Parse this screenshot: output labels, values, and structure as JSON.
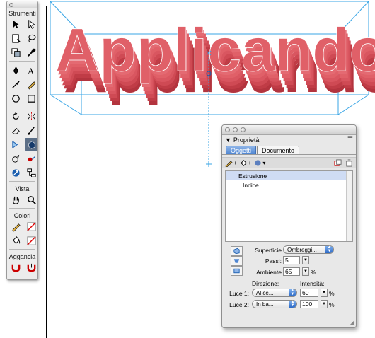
{
  "toolbox": {
    "title": "Strumenti",
    "section_view": "Vista",
    "section_colors": "Colori",
    "section_snap": "Aggancia"
  },
  "artwork": {
    "text": "Applicando",
    "face_color": "#e06068",
    "extrude_color": "#c43c46",
    "guide_color": "#3aa6e6"
  },
  "panel": {
    "title": "Proprietà",
    "tabs": {
      "objects": "Oggetti",
      "document": "Documento"
    },
    "list": {
      "item1": "Estrusione",
      "item2": "Indice"
    },
    "surface_label": "Superficie",
    "surface_value": "Ombreggi...",
    "steps_label": "Passi:",
    "steps_value": "5",
    "ambient_label": "Ambiente",
    "ambient_value": "65",
    "percent": "%",
    "direction_label": "Direzione:",
    "intensity_label": "Intensità:",
    "light1_label": "Luce 1:",
    "light1_direction": "Al ce...",
    "light1_intensity": "60",
    "light2_label": "Luce 2:",
    "light2_direction": "In ba...",
    "light2_intensity": "100"
  }
}
